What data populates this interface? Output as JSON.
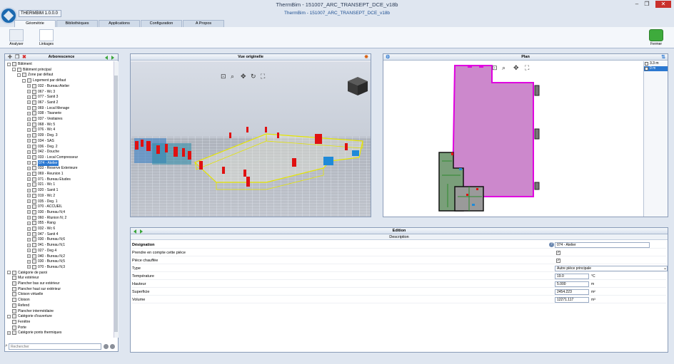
{
  "window": {
    "title": "ThermBim - 151007_ARC_TRANSEPT_DCE_v18b",
    "minimize": "–",
    "maximize": "❐",
    "close": "✕"
  },
  "app": {
    "version": "THERMBIM 1.0.0.0",
    "doc_title": "ThermBim - 151007_ARC_TRANSEPT_DCE_v18b"
  },
  "tabs": [
    "Géométrie",
    "Bibliothèques",
    "Applications",
    "Configuration",
    "A Propos"
  ],
  "ribbon": {
    "analyze_label": "Analyser",
    "linkages_label": "Linkages",
    "close_label": "Fermer"
  },
  "tree": {
    "title": "Arborescence",
    "search_placeholder": "Rechercher",
    "items": [
      {
        "label": "Bâtiment",
        "level": 0,
        "toggle": "-"
      },
      {
        "label": "Bâtiment principal",
        "level": 1,
        "toggle": "-"
      },
      {
        "label": "Zone par défaut",
        "level": 2,
        "toggle": "-"
      },
      {
        "label": "Logement par défaut",
        "level": 3,
        "toggle": "-"
      },
      {
        "label": "032 - Bureau Atelier",
        "level": 4,
        "toggle": "+"
      },
      {
        "label": "067 - Wc 3",
        "level": 4,
        "toggle": "+"
      },
      {
        "label": "077 - Sanit 3",
        "level": 4,
        "toggle": "+"
      },
      {
        "label": "067 - Sanit 2",
        "level": 4,
        "toggle": "+"
      },
      {
        "label": "069 - Local Menage",
        "level": 4,
        "toggle": "+"
      },
      {
        "label": "038 - Tisanerie",
        "level": 4,
        "toggle": "+"
      },
      {
        "label": "037 - Vestiaires",
        "level": 4,
        "toggle": "+"
      },
      {
        "label": "068 - Wc 5",
        "level": 4,
        "toggle": "+"
      },
      {
        "label": "076 - Wc 4",
        "level": 4,
        "toggle": "+"
      },
      {
        "label": "039 - Deg. 3",
        "level": 4,
        "toggle": "+"
      },
      {
        "label": "034 - SAS",
        "level": 4,
        "toggle": "+"
      },
      {
        "label": "036 - Deg. 2",
        "level": 4,
        "toggle": "+"
      },
      {
        "label": "042 - Douche",
        "level": 4,
        "toggle": "+"
      },
      {
        "label": "033 - Local Compresseur",
        "level": 4,
        "toggle": "+"
      },
      {
        "label": "074 - Atelier",
        "level": 4,
        "toggle": "+",
        "selected": true
      },
      {
        "label": "033 - Reserve Exterieure",
        "level": 4,
        "toggle": "+"
      },
      {
        "label": "069 - Reunion 1",
        "level": 4,
        "toggle": "+"
      },
      {
        "label": "071 - Bureau Etudes",
        "level": 4,
        "toggle": "+"
      },
      {
        "label": "021 - Wc 1",
        "level": 4,
        "toggle": "+"
      },
      {
        "label": "020 - Sanit 1",
        "level": 4,
        "toggle": "+"
      },
      {
        "label": "019 - Wc 2",
        "level": 4,
        "toggle": "+"
      },
      {
        "label": "035 - Deg. 1",
        "level": 4,
        "toggle": "+"
      },
      {
        "label": "070 - ACCUEIL",
        "level": 4,
        "toggle": "+"
      },
      {
        "label": "030 - Bureau N;4",
        "level": 4,
        "toggle": "+"
      },
      {
        "label": "060 - Rlunion N; 2",
        "level": 4,
        "toggle": "+"
      },
      {
        "label": "055 - Rang",
        "level": 4,
        "toggle": "+"
      },
      {
        "label": "032 - Wc 6",
        "level": 4,
        "toggle": "+"
      },
      {
        "label": "047 - Sanit 4",
        "level": 4,
        "toggle": "+"
      },
      {
        "label": "030 - Bureau N;6",
        "level": 4,
        "toggle": "+"
      },
      {
        "label": "041 - Bureau N;1",
        "level": 4,
        "toggle": "+"
      },
      {
        "label": "027 - Deg 4",
        "level": 4,
        "toggle": "+"
      },
      {
        "label": "040 - Bureau N;2",
        "level": 4,
        "toggle": "+"
      },
      {
        "label": "030 - Bureau N;5",
        "level": 4,
        "toggle": "+"
      },
      {
        "label": "070 - Bureau N;3",
        "level": 4,
        "toggle": "+"
      },
      {
        "label": "Catégorie de paroi",
        "level": 0,
        "toggle": "-"
      },
      {
        "label": "Mur extérieur",
        "level": 1,
        "toggle": ""
      },
      {
        "label": "Plancher bas sur extérieur",
        "level": 1,
        "toggle": ""
      },
      {
        "label": "Plancher haut sur extérieur",
        "level": 1,
        "toggle": ""
      },
      {
        "label": "Cloison virtuelle",
        "level": 1,
        "toggle": ""
      },
      {
        "label": "Cloison",
        "level": 1,
        "toggle": ""
      },
      {
        "label": "Refend",
        "level": 1,
        "toggle": ""
      },
      {
        "label": "Plancher intermédiaire",
        "level": 1,
        "toggle": ""
      },
      {
        "label": "Catégorie d'ouverture",
        "level": 0,
        "toggle": "-"
      },
      {
        "label": "Fenêtre",
        "level": 1,
        "toggle": ""
      },
      {
        "label": "Porte",
        "level": 1,
        "toggle": ""
      },
      {
        "label": "Catégorie ponts thermiques",
        "level": 0,
        "toggle": "+"
      }
    ]
  },
  "view3d": {
    "title": "Vue originelle"
  },
  "plan": {
    "title": "Plan",
    "levels": [
      {
        "label": "3.3 m",
        "selected": false
      },
      {
        "label": "0 m",
        "selected": true
      }
    ]
  },
  "edition": {
    "title": "Edition",
    "subtitle": "Description",
    "rows": [
      {
        "label": "Désignation",
        "kind": "text",
        "value": "074 - Atelier",
        "bold": true,
        "info": "?"
      },
      {
        "label": "Prendre en compte cette pièce",
        "kind": "check",
        "value": "✓"
      },
      {
        "label": "Pièce chauffée",
        "kind": "check",
        "value": "✓"
      },
      {
        "label": "Type",
        "kind": "select",
        "value": "Autre pièce principale"
      },
      {
        "label": "Température",
        "kind": "num",
        "value": "19.0",
        "unit": "°C"
      },
      {
        "label": "Hauteur",
        "kind": "num",
        "value": "5.000",
        "unit": "m"
      },
      {
        "label": "Superficie",
        "kind": "num",
        "value": "2454.223",
        "unit": "m²"
      },
      {
        "label": "Volume",
        "kind": "num",
        "value": "12271.117",
        "unit": "m³"
      }
    ]
  },
  "colors": {
    "accent": "#2b78d1",
    "room_fill": "#cc88cc",
    "room_outline": "#e000e0",
    "walls_3d": "#e5e500"
  }
}
